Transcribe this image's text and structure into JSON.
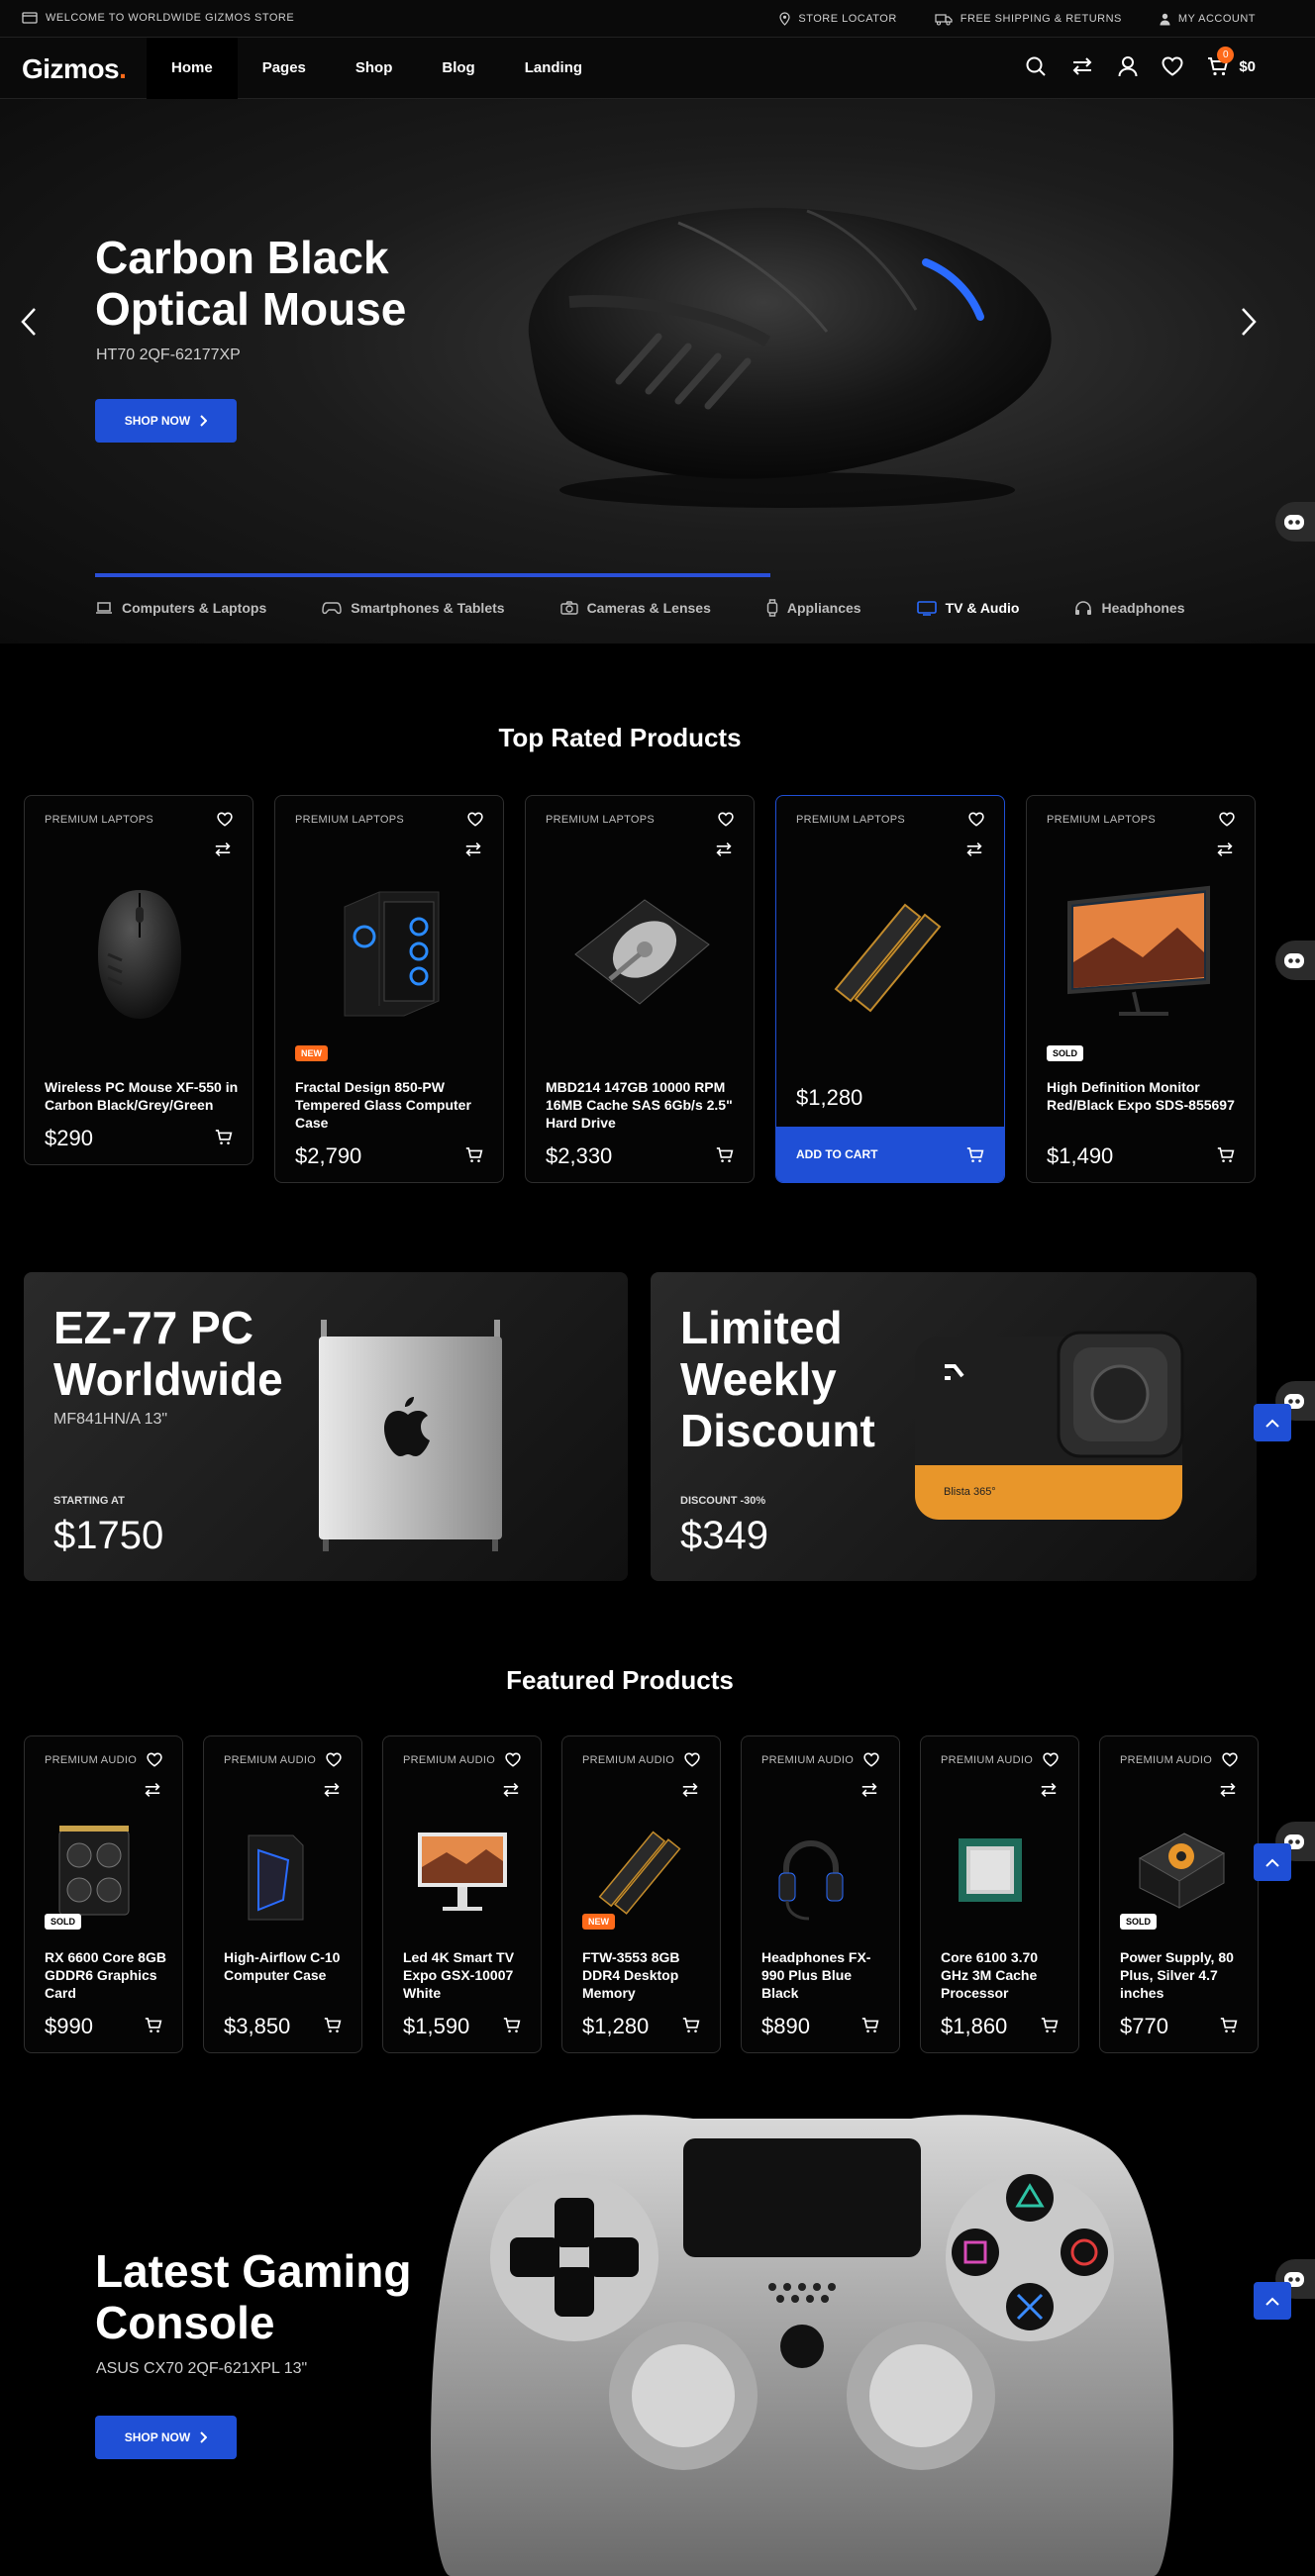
{
  "topbar": {
    "welcome": "WELCOME TO WORLDWIDE GIZMOS STORE",
    "store_locator": "STORE LOCATOR",
    "shipping": "FREE SHIPPING & RETURNS",
    "account": "MY ACCOUNT"
  },
  "nav": {
    "logo": "Gizmos",
    "logo_dot": ".",
    "menu": [
      "Home",
      "Pages",
      "Shop",
      "Blog",
      "Landing"
    ],
    "cart_count": "0",
    "cart_total": "$0"
  },
  "hero": {
    "title": "Carbon Black Optical Mouse",
    "subtitle": "HT70 2QF-62177XP",
    "button": "SHOP NOW",
    "progress": 0.6,
    "categories": [
      "Computers & Laptops",
      "Smartphones & Tablets",
      "Cameras & Lenses",
      "Appliances",
      "TV & Audio",
      "Headphones"
    ],
    "active_category": "TV & Audio"
  },
  "top_rated": {
    "title": "Top Rated Products",
    "products": [
      {
        "category": "PREMIUM LAPTOPS",
        "name": "Wireless PC Mouse XF-550 in Carbon Black/Grey/Green",
        "price": "$290",
        "badge": ""
      },
      {
        "category": "PREMIUM LAPTOPS",
        "name": "Fractal Design 850-PW Tempered Glass Computer Case",
        "price": "$2,790",
        "badge": "NEW"
      },
      {
        "category": "PREMIUM LAPTOPS",
        "name": "MBD214 147GB 10000 RPM 16MB Cache SAS 6Gb/s 2.5\" Hard Drive",
        "price": "$2,330",
        "badge": ""
      },
      {
        "category": "PREMIUM LAPTOPS",
        "name": "",
        "price": "$1,280",
        "badge": "",
        "add_to_cart": "ADD TO CART"
      },
      {
        "category": "PREMIUM LAPTOPS",
        "name": "High Definition Monitor Red/Black Expo SDS-855697",
        "price": "$1,490",
        "badge": "SOLD"
      }
    ]
  },
  "promos": [
    {
      "title": "EZ-77 PC Worldwide",
      "subtitle": "MF841HN/A 13\"",
      "label": "STARTING AT",
      "price": "$1750"
    },
    {
      "title": "Limited Weekly Discount",
      "subtitle": "",
      "label": "DISCOUNT -30%",
      "price": "$349",
      "product_text": "Blista 365°"
    }
  ],
  "featured": {
    "title": "Featured Products",
    "products": [
      {
        "category": "PREMIUM AUDIO",
        "name": "RX 6600 Core 8GB GDDR6 Graphics Card",
        "price": "$990",
        "badge": "SOLD"
      },
      {
        "category": "PREMIUM AUDIO",
        "name": "High-Airflow C-10 Computer Case",
        "price": "$3,850",
        "badge": ""
      },
      {
        "category": "PREMIUM AUDIO",
        "name": "Led 4K Smart TV Expo GSX-10007 White",
        "price": "$1,590",
        "badge": ""
      },
      {
        "category": "PREMIUM AUDIO",
        "name": "FTW-3553 8GB DDR4 Desktop Memory",
        "price": "$1,280",
        "badge": "NEW"
      },
      {
        "category": "PREMIUM AUDIO",
        "name": "Headphones FX-990 Plus Blue Black",
        "price": "$890",
        "badge": ""
      },
      {
        "category": "PREMIUM AUDIO",
        "name": "Core 6100 3.70 GHz 3M Cache Processor",
        "price": "$1,860",
        "badge": ""
      },
      {
        "category": "PREMIUM AUDIO",
        "name": "Power Supply, 80 Plus, Silver 4.7 inches",
        "price": "$770",
        "badge": "SOLD"
      }
    ]
  },
  "gaming": {
    "title": "Latest Gaming Console",
    "subtitle": "ASUS CX70 2QF-621XPL 13\"",
    "button": "SHOP NOW"
  },
  "colors": {
    "accent": "#1f4fd6",
    "brand_orange": "#ff6a1a",
    "background": "#000000"
  }
}
